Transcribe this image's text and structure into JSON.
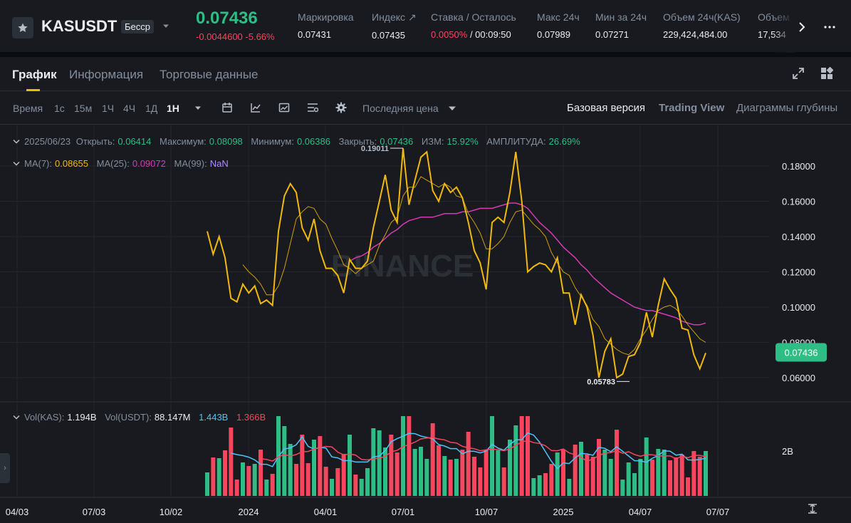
{
  "header": {
    "symbol": "KASUSDT",
    "contract_type": "Бесср",
    "last_price": "0.07436",
    "change": "-0.0044600 -5.66%",
    "stats": [
      {
        "label": "Маркировка",
        "value": "0.07431"
      },
      {
        "label": "Индекс ↗",
        "value": "0.07435"
      },
      {
        "label": "Ставка / Осталось",
        "value_red": "0.0050%",
        "value_rest": " / 00:09:50"
      },
      {
        "label": "Макс 24ч",
        "value": "0.07989"
      },
      {
        "label": "Мин за 24ч",
        "value": "0.07271"
      },
      {
        "label": "Объем 24ч(KAS)",
        "value": "229,424,484.00"
      },
      {
        "label": "Объем",
        "value": "17,534"
      }
    ]
  },
  "tabs": [
    "График",
    "Информация",
    "Торговые данные"
  ],
  "toolbar": {
    "time_label": "Время",
    "intervals": [
      "1с",
      "15м",
      "1Ч",
      "4Ч",
      "1Д",
      "1Н"
    ],
    "active_interval": "1Н",
    "price_type": "Последняя цена",
    "views": [
      "Базовая версия",
      "Trading View",
      "Диаграммы глубины"
    ]
  },
  "ohlc": {
    "date": "2025/06/23",
    "open_label": "Открыть:",
    "open": "0.06414",
    "high_label": "Максимум:",
    "high": "0.08098",
    "low_label": "Минимум:",
    "low": "0.06386",
    "close_label": "Закрыть:",
    "close": "0.07436",
    "change_label": "ИЗМ:",
    "change": "15.92%",
    "amp_label": "АМПЛИТУДА:",
    "amp": "26.69%"
  },
  "ma": {
    "ma7_label": "MA(7):",
    "ma7": "0.08655",
    "ma25_label": "MA(25):",
    "ma25": "0.09072",
    "ma99_label": "MA(99):",
    "ma99": "NaN"
  },
  "vol": {
    "kas_label": "Vol(KAS):",
    "kas": "1.194B",
    "usdt_label": "Vol(USDT):",
    "usdt": "88.147M",
    "ma1": "1.443B",
    "ma2": "1.366B",
    "axis_tick": "2B"
  },
  "watermark": "BINANCE",
  "colors": {
    "up": "#2ebd85",
    "down": "#f6465d",
    "price": "#f0b90b",
    "ma7": "#f0b90b",
    "ma25": "#d63ab5",
    "vol_ma1": "#4fc3f7",
    "vol_ma2": "#f6465d"
  },
  "chart_data": {
    "type": "line",
    "y_ticks": [
      "0.18000",
      "0.16000",
      "0.14000",
      "0.12000",
      "0.10000",
      "0.08000",
      "0.06000"
    ],
    "y_values": [
      0.18,
      0.16,
      0.14,
      0.12,
      0.1,
      0.08,
      0.06
    ],
    "x_ticks": [
      "04/03",
      "07/03",
      "10/02",
      "2024",
      "04/01",
      "07/01",
      "10/07",
      "2025",
      "04/07",
      "07/07"
    ],
    "price_label": "0.07436",
    "high_marker": "0.19011",
    "low_marker": "0.05783",
    "close_series": [
      0.143,
      0.13,
      0.14,
      0.128,
      0.105,
      0.103,
      0.113,
      0.108,
      0.112,
      0.102,
      0.104,
      0.101,
      0.143,
      0.163,
      0.17,
      0.165,
      0.145,
      0.138,
      0.15,
      0.132,
      0.122,
      0.122,
      0.118,
      0.108,
      0.127,
      0.122,
      0.122,
      0.126,
      0.145,
      0.16,
      0.175,
      0.155,
      0.148,
      0.19,
      0.158,
      0.172,
      0.185,
      0.188,
      0.166,
      0.16,
      0.17,
      0.165,
      0.168,
      0.162,
      0.148,
      0.132,
      0.125,
      0.11,
      0.148,
      0.151,
      0.148,
      0.165,
      0.188,
      0.16,
      0.12,
      0.123,
      0.125,
      0.124,
      0.12,
      0.128,
      0.108,
      0.108,
      0.09,
      0.107,
      0.1,
      0.084,
      0.06,
      0.075,
      0.082,
      0.06,
      0.062,
      0.072,
      0.073,
      0.08,
      0.097,
      0.083,
      0.101,
      0.116,
      0.11,
      0.105,
      0.088,
      0.087,
      0.073,
      0.065,
      0.074
    ],
    "ma7_series": [
      null,
      null,
      null,
      null,
      null,
      null,
      0.124,
      0.12,
      0.117,
      0.113,
      0.107,
      0.107,
      0.112,
      0.122,
      0.136,
      0.15,
      0.154,
      0.157,
      0.156,
      0.15,
      0.147,
      0.139,
      0.132,
      0.124,
      0.122,
      0.119,
      0.122,
      0.124,
      0.126,
      0.135,
      0.141,
      0.148,
      0.151,
      0.163,
      0.168,
      0.168,
      0.174,
      0.172,
      0.17,
      0.168,
      0.17,
      0.168,
      0.163,
      0.162,
      0.153,
      0.148,
      0.142,
      0.133,
      0.133,
      0.136,
      0.14,
      0.148,
      0.154,
      0.155,
      0.151,
      0.147,
      0.144,
      0.14,
      0.131,
      0.125,
      0.12,
      0.118,
      0.111,
      0.106,
      0.101,
      0.093,
      0.089,
      0.082,
      0.079,
      0.076,
      0.074,
      0.073,
      0.076,
      0.082,
      0.087,
      0.093,
      0.098,
      0.1,
      0.101,
      0.099,
      0.095,
      0.09,
      0.086,
      0.082,
      0.08
    ],
    "ma25_series": [
      null,
      null,
      null,
      null,
      null,
      null,
      null,
      null,
      null,
      null,
      null,
      null,
      null,
      null,
      null,
      null,
      null,
      null,
      null,
      null,
      null,
      null,
      null,
      null,
      0.126,
      0.128,
      0.129,
      0.131,
      0.134,
      0.136,
      0.139,
      0.142,
      0.144,
      0.147,
      0.149,
      0.15,
      0.151,
      0.151,
      0.151,
      0.152,
      0.153,
      0.153,
      0.153,
      0.154,
      0.154,
      0.155,
      0.156,
      0.156,
      0.156,
      0.157,
      0.158,
      0.159,
      0.159,
      0.158,
      0.156,
      0.152,
      0.148,
      0.145,
      0.142,
      0.138,
      0.134,
      0.131,
      0.128,
      0.124,
      0.121,
      0.117,
      0.114,
      0.111,
      0.108,
      0.106,
      0.104,
      0.102,
      0.1,
      0.099,
      0.098,
      0.098,
      0.097,
      0.096,
      0.095,
      0.094,
      0.092,
      0.091,
      0.09,
      0.09,
      0.091
    ]
  }
}
